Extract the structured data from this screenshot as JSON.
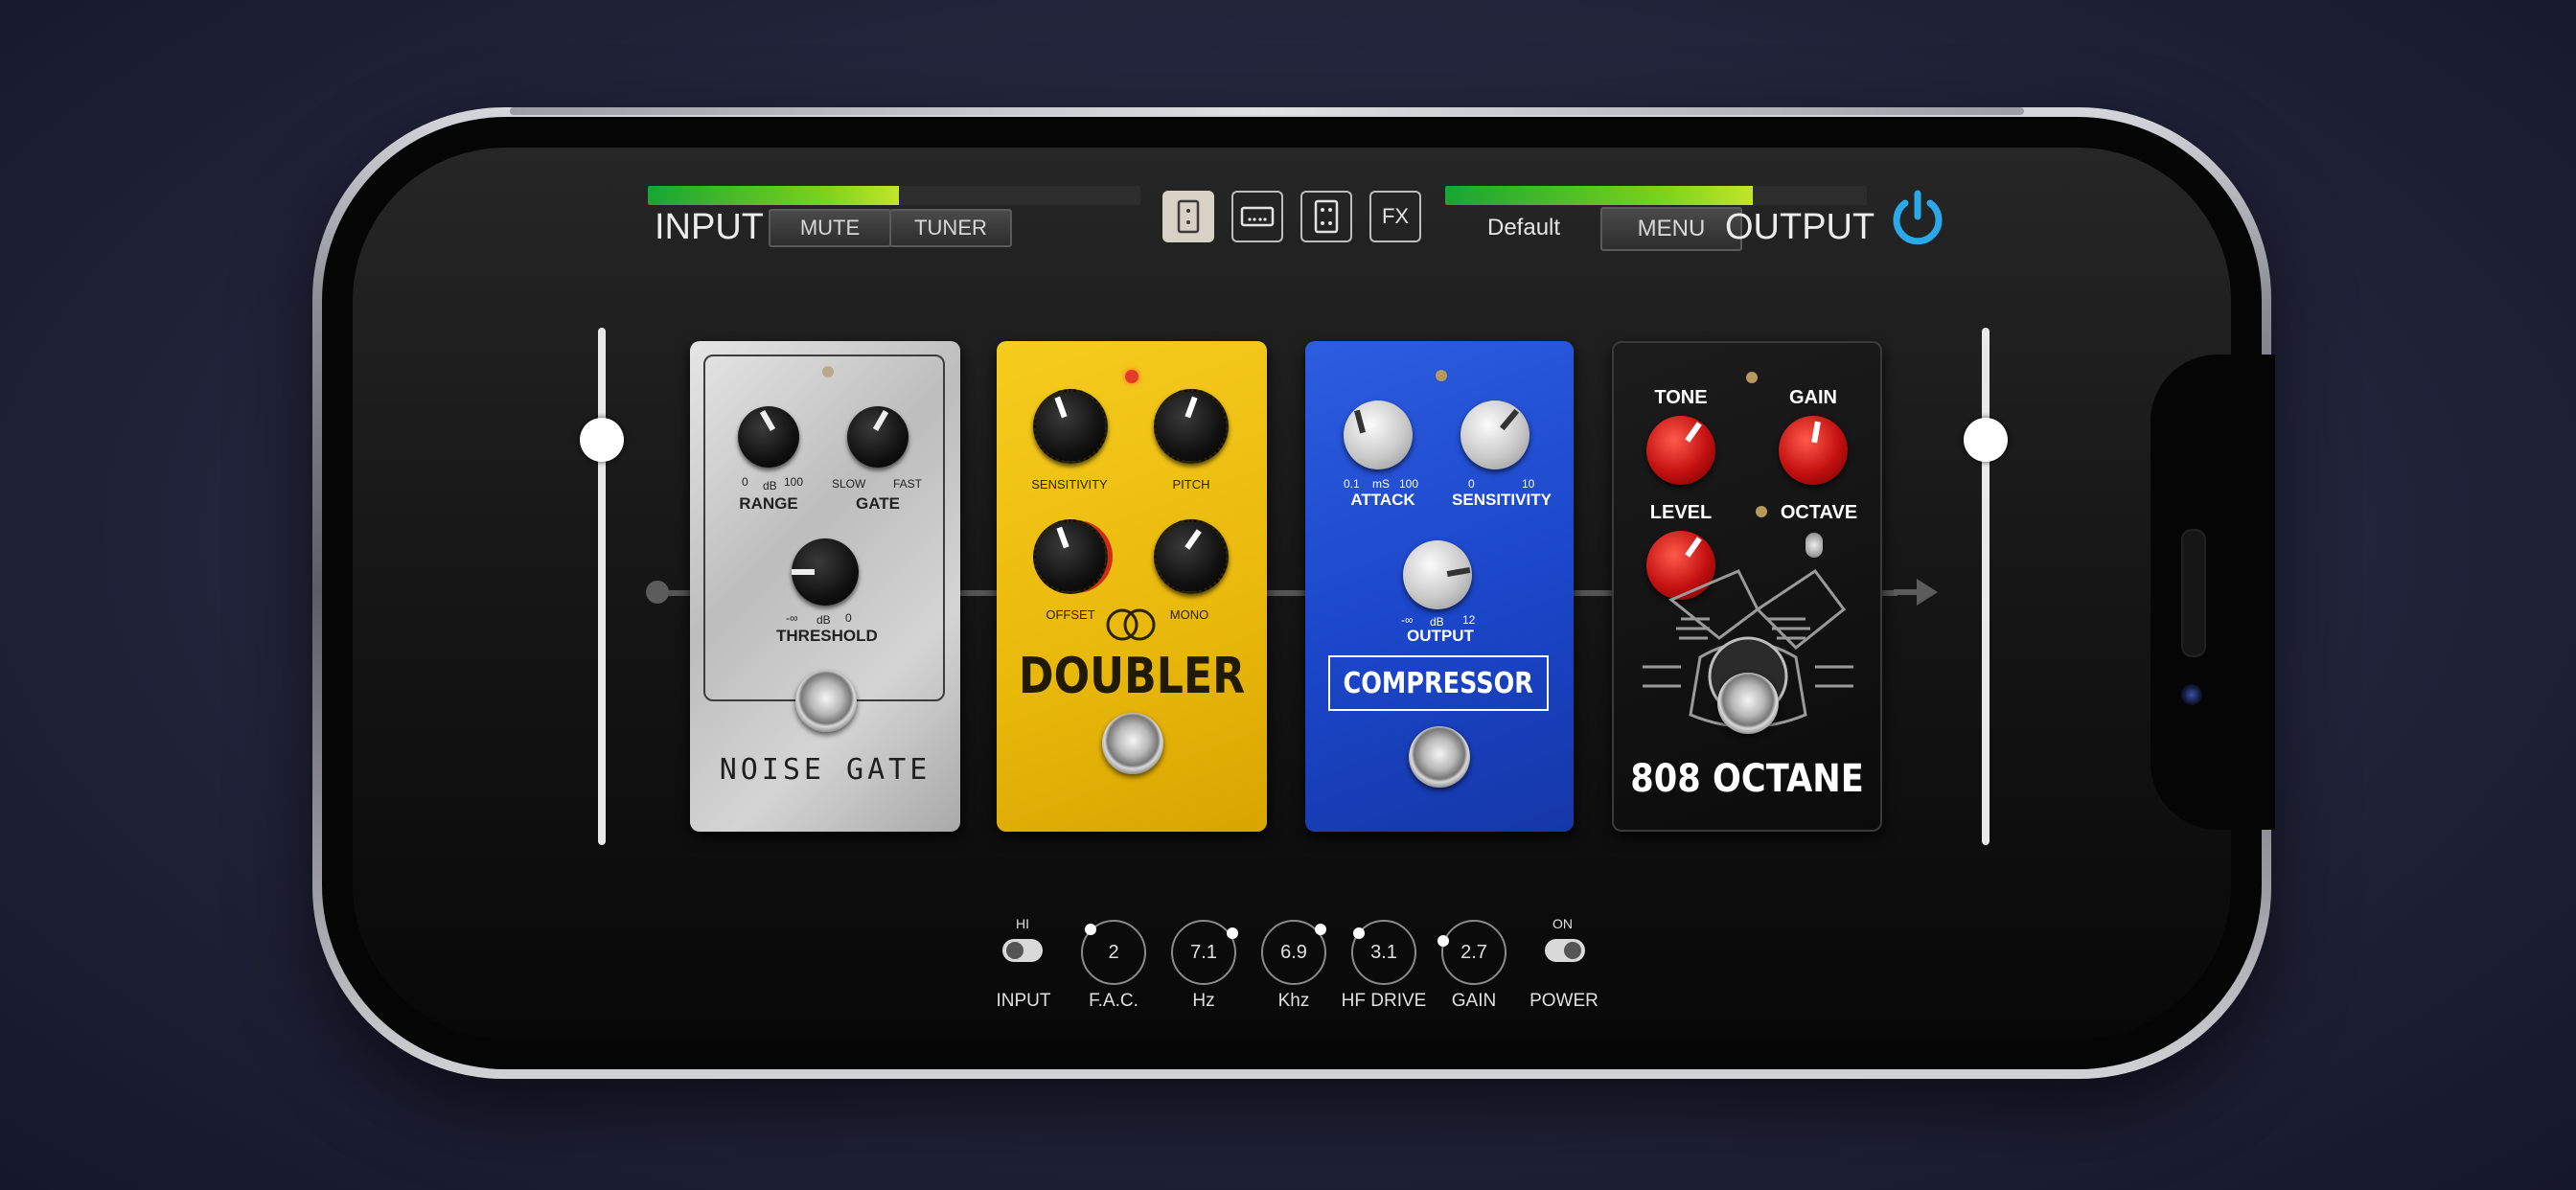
{
  "header": {
    "input_label": "INPUT",
    "mute_label": "MUTE",
    "tuner_label": "TUNER",
    "fx_label": "FX",
    "preset_name": "Default",
    "menu_label": "MENU",
    "output_label": "OUTPUT",
    "input_level": 0.51,
    "output_level": 0.73,
    "accent_color": "#2aa9e8"
  },
  "view_buttons": [
    {
      "icon": "single-pedal-icon",
      "active": true
    },
    {
      "icon": "rack-icon",
      "active": false
    },
    {
      "icon": "dual-pedal-icon",
      "active": false
    },
    {
      "icon": "fx-icon",
      "active": false
    }
  ],
  "sliders": {
    "input_fraction": 0.87,
    "output_fraction": 0.87
  },
  "pedals": {
    "noise_gate": {
      "name": "NOISE GATE",
      "range_label": "RANGE",
      "range_min": "0",
      "range_unit": "dB",
      "range_max": "100",
      "gate_label": "GATE",
      "gate_min": "SLOW",
      "gate_max": "FAST",
      "threshold_label": "THRESHOLD",
      "threshold_min": "-∞",
      "threshold_unit": "dB",
      "threshold_max": "0"
    },
    "doubler": {
      "name": "DOUBLER",
      "sensitivity_label": "SENSITIVITY",
      "pitch_label": "PITCH",
      "offset_label": "OFFSET",
      "mono_label": "MONO"
    },
    "compressor": {
      "name": "COMPRESSOR",
      "attack_label": "ATTACK",
      "attack_min": "0.1",
      "attack_unit": "mS",
      "attack_max": "100",
      "sensitivity_label": "SENSITIVITY",
      "sensitivity_min": "0",
      "sensitivity_max": "10",
      "output_label": "OUTPUT",
      "output_min": "-∞",
      "output_unit": "dB",
      "output_max": "12"
    },
    "octane": {
      "name": "808 OCTANE",
      "tone_label": "TONE",
      "gain_label": "GAIN",
      "level_label": "LEVEL",
      "octave_label": "OCTAVE"
    }
  },
  "bottom_controls": {
    "input_toggle_state": "HI",
    "input_label": "INPUT",
    "knobs": [
      {
        "value": "2",
        "label": "F.A.C."
      },
      {
        "value": "7.1",
        "label": "Hz"
      },
      {
        "value": "6.9",
        "label": "Khz"
      },
      {
        "value": "3.1",
        "label": "HF DRIVE"
      },
      {
        "value": "2.7",
        "label": "GAIN"
      }
    ],
    "power_toggle_state": "ON",
    "power_label": "POWER"
  }
}
